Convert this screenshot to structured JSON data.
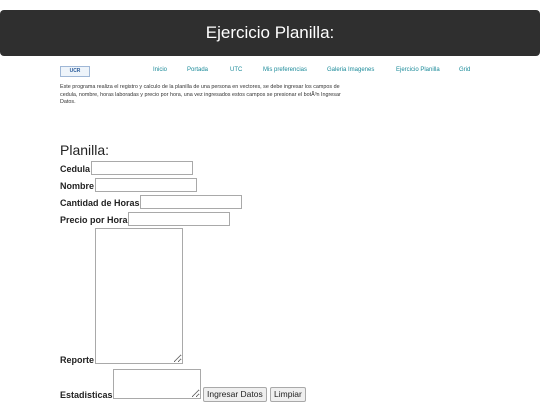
{
  "header": {
    "title": "Ejercicio Planilla:"
  },
  "nav": {
    "logo_text": "UCR",
    "items": [
      "Inicio",
      "Portada",
      "UTC",
      "Mis preferencias",
      "Galeria Imagenes",
      "Ejercicio Planilla",
      "Grid"
    ]
  },
  "intro": {
    "text": "Este programa realiza el registro y calculo de la planilla de una persona en vectores, se debe ingresar los campos de cedula, nombre, horas laboradas y precio por hora, una vez ingresados estos campos se presionar el botÃ³n Ingresar Datos."
  },
  "form": {
    "title": "Planilla:",
    "cedula_label": "Cedula",
    "cedula_value": "",
    "nombre_label": "Nombre",
    "nombre_value": "",
    "horas_label": "Cantidad de Horas",
    "horas_value": "",
    "precio_label": "Precio por Hora",
    "precio_value": "",
    "reporte_label": "Reporte",
    "estadisticas_label": "Estadisticas",
    "ingresar_label": "Ingresar Datos",
    "limpiar_label": "Limpiar"
  }
}
